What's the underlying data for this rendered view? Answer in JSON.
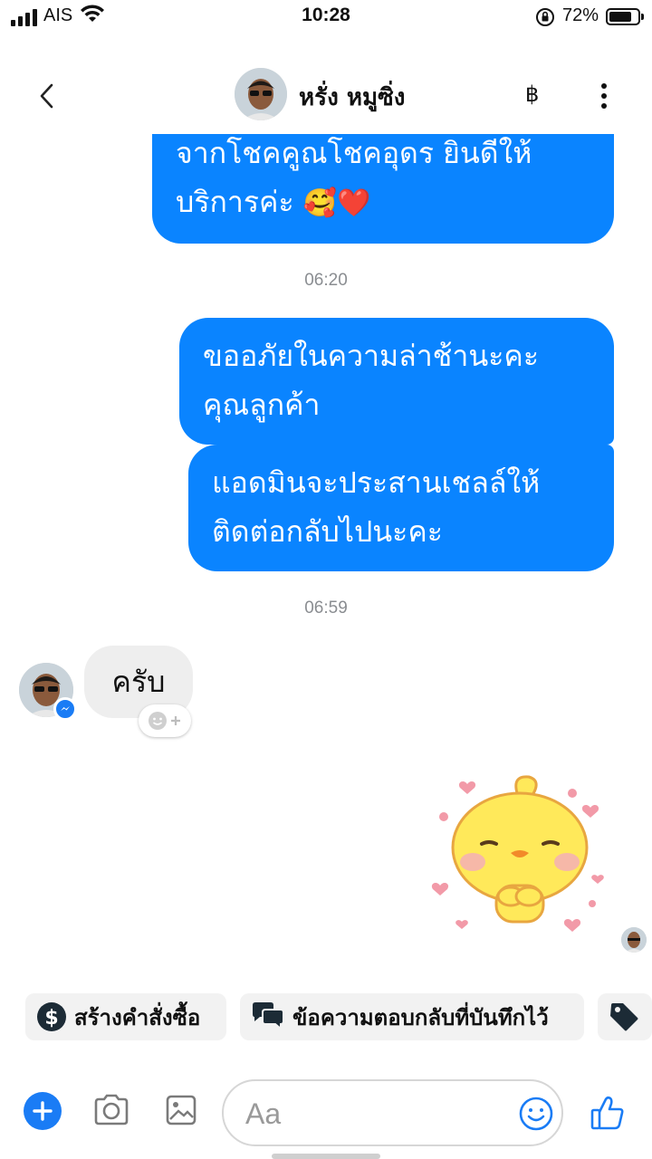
{
  "status_bar": {
    "carrier": "AIS",
    "time": "10:28",
    "battery_percent": "72%",
    "icons": [
      "signal-icon",
      "wifi-icon",
      "rotation-lock-icon",
      "battery-icon"
    ]
  },
  "header": {
    "contact_name": "หรั่ง หมูซิ่ง",
    "payment_symbol": "฿",
    "icons": [
      "back-icon",
      "payment-icon",
      "more-icon"
    ]
  },
  "messages": {
    "outgoing_1": {
      "line1": "จากโชคคูณโชคอุดร ยินดีให้",
      "line2": "บริการค่ะ",
      "emoji": "🥰❤️"
    },
    "timestamp_1": "06:20",
    "outgoing_2": {
      "line1": "ขออภัยในความล่าช้านะคะ",
      "line2": "คุณลูกค้า"
    },
    "outgoing_3": {
      "line1": "แอดมินจะประสานเชลล์ให้",
      "line2": "ติดต่อกลับไปนะคะ"
    },
    "timestamp_2": "06:59",
    "incoming_1": "ครับ",
    "sticker": "yellow-chick-sticker"
  },
  "quick_replies": [
    {
      "label": "สร้างคำสั่งซื้อ",
      "icon": "dollar-icon"
    },
    {
      "label": "ข้อความตอบกลับที่บันทึกไว้",
      "icon": "chat-bubbles-icon"
    },
    {
      "label": "",
      "icon": "tag-icon"
    }
  ],
  "composer": {
    "placeholder": "Aa",
    "value": "",
    "icons": [
      "plus-icon",
      "camera-icon",
      "gallery-icon",
      "emoji-icon",
      "thumbs-up-icon"
    ]
  },
  "colors": {
    "outgoing_bubble": "#0a84ff",
    "incoming_bubble": "#eeeeee",
    "accent": "#1a7cf5",
    "timestamp": "#8a8d91"
  }
}
